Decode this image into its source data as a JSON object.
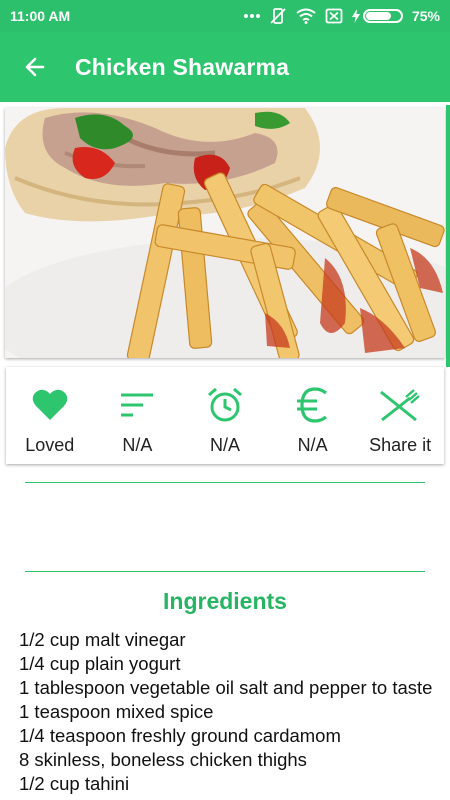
{
  "status_bar": {
    "time": "11:00 AM",
    "dots_icon": "more-dots-icon",
    "battery_percent": "75%",
    "battery_level": 0.75
  },
  "app_bar": {
    "title": "Chicken Shawarma",
    "back_icon": "arrow-back-icon"
  },
  "actions": [
    {
      "icon": "heart-icon",
      "label": "Loved"
    },
    {
      "icon": "sort-lines-icon",
      "label": "N/A"
    },
    {
      "icon": "alarm-clock-icon",
      "label": "N/A"
    },
    {
      "icon": "euro-icon",
      "label": "N/A"
    },
    {
      "icon": "fork-knife-icon",
      "label": "Share it"
    }
  ],
  "ingredients": {
    "title": "Ingredients",
    "items": [
      "1/2 cup malt vinegar",
      "1/4 cup plain yogurt",
      "1 tablespoon vegetable oil salt and pepper to taste 1 teaspoon mixed spice",
      "1/4 teaspoon freshly ground cardamom",
      "8 skinless, boneless chicken thighs",
      "1/2 cup tahini"
    ]
  },
  "colors": {
    "primary": "#2ec56f",
    "primary_dark": "#2cc06c",
    "accent_text": "#27b564"
  }
}
